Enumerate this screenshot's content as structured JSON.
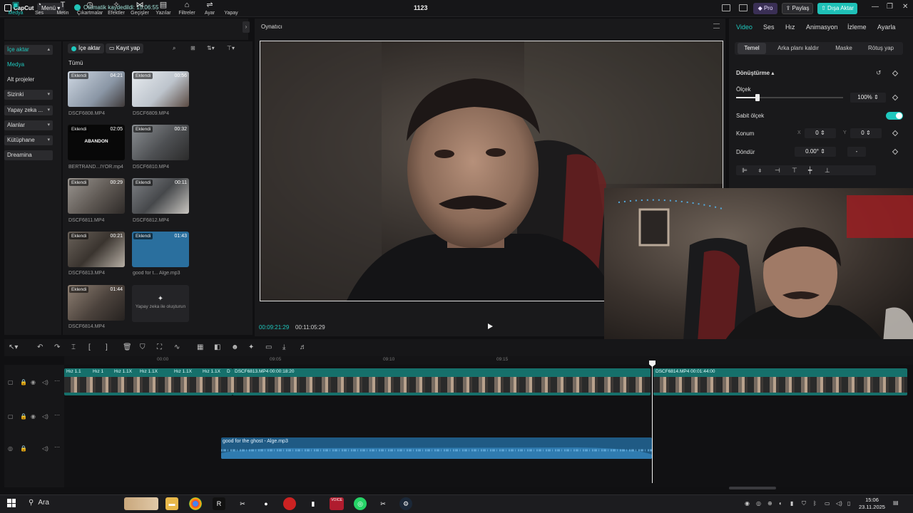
{
  "app": {
    "logo": "CapCut",
    "menu_label": "Menü",
    "autosave": "Otomatik kaydedildi: 15:06:55",
    "project_name": "1123",
    "pro_label": "Pro",
    "share_label": "Paylaş",
    "export_label": "Dışa Aktar"
  },
  "left_tabs": [
    "Medya",
    "Ses",
    "Metin",
    "Çıkartmalar",
    "Efektler",
    "Geçişler",
    "Yazılar",
    "Filtreler",
    "Ayar",
    "Yapay"
  ],
  "left_nav": [
    {
      "label": "İçe aktar",
      "selected": true,
      "chevron": "▴"
    },
    {
      "label": "Medya",
      "selected": false,
      "accent": true
    },
    {
      "label": "Alt projeler",
      "selected": false
    },
    {
      "label": "Sizinki",
      "selected": false,
      "chevron": "▾"
    },
    {
      "label": "Yapay zeka ...",
      "selected": false,
      "chevron": "▾"
    },
    {
      "label": "Alanlar",
      "selected": false,
      "chevron": "▾"
    },
    {
      "label": "Kütüphane",
      "selected": false,
      "chevron": "▾"
    },
    {
      "label": "Dreamina",
      "selected": false
    }
  ],
  "media_panel": {
    "import_label": "İçe aktar",
    "record_label": "Kayıt yap",
    "all_label": "Tümü",
    "added_badge": "Eklendi",
    "items": [
      {
        "name": "DSCF6808.MP4",
        "duration": "04:21",
        "kind": "video"
      },
      {
        "name": "DSCF6809.MP4",
        "duration": "00:56",
        "kind": "video"
      },
      {
        "name": "BERTRAND...İYOR.mp4",
        "duration": "02:05",
        "kind": "dark",
        "overlay_text": "ABANDON"
      },
      {
        "name": "DSCF6810.MP4",
        "duration": "00:32",
        "kind": "video"
      },
      {
        "name": "DSCF6811.MP4",
        "duration": "00:29",
        "kind": "video"
      },
      {
        "name": "DSCF6812.MP4",
        "duration": "00:11",
        "kind": "video"
      },
      {
        "name": "DSCF6813.MP4",
        "duration": "00:21",
        "kind": "video"
      },
      {
        "name": "good for t... Alge.mp3",
        "duration": "01:43",
        "kind": "audio"
      },
      {
        "name": "DSCF6814.MP4",
        "duration": "01:44",
        "kind": "video"
      }
    ],
    "ai_generate_label": "Yapay zeka ile oluşturun"
  },
  "player": {
    "title": "Oynatıcı",
    "current_time": "00:09:21:29",
    "total_time": "00:11:05:29"
  },
  "inspector": {
    "tabs": [
      "Video",
      "Ses",
      "Hız",
      "Animasyon",
      "İzleme",
      "Ayarla"
    ],
    "subtabs": [
      "Temel",
      "Arka planı kaldır",
      "Maske",
      "Rötuş yap"
    ],
    "section_title": "Dönüştürme",
    "scale_label": "Ölçek",
    "scale_value": "100%",
    "scale_fraction": 1.0,
    "uniform_scale_label": "Sabit ölçek",
    "uniform_scale_on": true,
    "position_label": "Konum",
    "pos_x_label": "X",
    "pos_x": "0",
    "pos_y_label": "Y",
    "pos_y": "0",
    "rotate_label": "Döndür",
    "rotate_value": "0.00°",
    "rotate_dash": "-"
  },
  "timeline": {
    "ruler_ticks": [
      "00:00",
      "09:05",
      "09:10",
      "09:15"
    ],
    "speed_clips": [
      "Hız 1.1",
      "Hız 1",
      "Hız 1.1X",
      "Hız 1.1X",
      "Hız 1.1X",
      "Hız 1.1X",
      "D"
    ],
    "clip_a_label": "DSCF6813.MP4  00:00:18:20",
    "clip_b_label": "DSCF6814.MP4  00:01:44:00",
    "audio_label": "good for the ghost - Alge.mp3"
  },
  "taskbar": {
    "search_label": "Ara",
    "time": "15:06",
    "date": "23.11.2025"
  }
}
